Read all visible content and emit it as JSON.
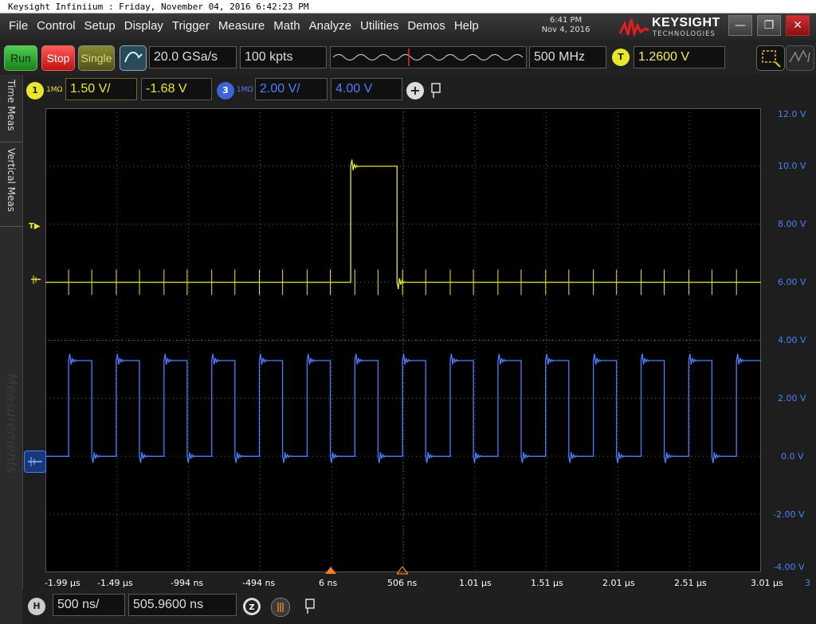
{
  "window": {
    "title": "Keysight Infiniium : Friday, November 04, 2016 6:42:23 PM"
  },
  "menu": [
    "File",
    "Control",
    "Setup",
    "Display",
    "Trigger",
    "Measure",
    "Math",
    "Analyze",
    "Utilities",
    "Demos",
    "Help"
  ],
  "clock": {
    "time": "6:41 PM",
    "date": "Nov 4, 2016"
  },
  "brand": {
    "name": "KEYSIGHT",
    "sub": "TECHNOLOGIES"
  },
  "window_controls": {
    "minimize": "—",
    "restore": "❐",
    "close": "✕"
  },
  "toolbar": {
    "run": "Run",
    "stop": "Stop",
    "single": "Single",
    "sample_rate": "20.0 GSa/s",
    "memory_depth": "100 kpts",
    "bandwidth": "500 MHz",
    "trigger_badge": "T",
    "trigger_level": "1.2600 V"
  },
  "channels": {
    "ch1": {
      "number": "1",
      "impedance": "1MΩ",
      "scale": "1.50 V/",
      "offset": "-1.68 V",
      "color": "#e8e82a"
    },
    "ch3": {
      "number": "3",
      "impedance": "1MΩ",
      "scale": "2.00 V/",
      "offset": "4.00 V",
      "color": "#4a7fff"
    },
    "add_symbol": "+"
  },
  "side_tabs": [
    "Time Meas",
    "Vertical Meas",
    "Measurements"
  ],
  "screen_markers": {
    "trigger": "T"
  },
  "axes": {
    "x_ticks": [
      "-1.99 µs",
      "-1.49 µs",
      "-994 ns",
      "-494 ns",
      "6 ns",
      "506 ns",
      "1.01 µs",
      "1.51 µs",
      "2.01 µs",
      "2.51 µs",
      "3.01 µs"
    ],
    "x_suffix": "3",
    "y_ticks": [
      "12.0 V",
      "10.0 V",
      "8.00 V",
      "6.00 V",
      "4.00 V",
      "2.00 V",
      "0.0 V",
      "-2.00 V",
      "-4.00 V"
    ]
  },
  "horizontal": {
    "badge": "H",
    "scale": "500 ns/",
    "position": "505.9600 ns"
  },
  "chart_data": {
    "type": "line",
    "title": "",
    "xlabel": "",
    "ylabel": "",
    "x_unit": "s",
    "y_unit": "V",
    "xlim": [
      -2.24e-06,
      3.01e-06
    ],
    "ylim": [
      -4.0,
      12.0
    ],
    "grid": true,
    "series": [
      {
        "name": "1",
        "color": "#e8e82a",
        "x": [
          -2.24e-06,
          0.0,
          0.0,
          3.4e-07,
          3.4e-07,
          3.01e-06
        ],
        "y": [
          6.0,
          6.0,
          10.0,
          10.0,
          6.0,
          6.0
        ]
      },
      {
        "name": "3",
        "color": "#4a7fff",
        "x": [
          -2.24e-06,
          -2.07e-06,
          -2.07e-06,
          -1.9e-06,
          -1.9e-06,
          -1.72e-06,
          -1.72e-06,
          -1.55e-06,
          -1.55e-06,
          -1.37e-06,
          -1.37e-06,
          -1.2e-06,
          -1.2e-06,
          -1.02e-06,
          -1.02e-06,
          -8.5e-07,
          -8.5e-07,
          -6.7e-07,
          -6.7e-07,
          -5e-07,
          -5e-07,
          -3.2e-07,
          -3.2e-07,
          -1.5e-07,
          -1.5e-07,
          3e-08,
          3e-08,
          2e-07,
          2e-07,
          3.8e-07,
          3.8e-07,
          5.5e-07,
          5.5e-07,
          7.3e-07,
          7.3e-07,
          9e-07,
          9e-07,
          1.08e-06,
          1.08e-06,
          1.25e-06,
          1.25e-06,
          1.43e-06,
          1.43e-06,
          1.6e-06,
          1.6e-06,
          1.78e-06,
          1.78e-06,
          1.95e-06,
          1.95e-06,
          2.13e-06,
          2.13e-06,
          2.3e-06,
          2.3e-06,
          2.48e-06,
          2.48e-06,
          2.65e-06,
          2.65e-06,
          2.83e-06,
          2.83e-06,
          3.01e-06
        ],
        "y": [
          0.0,
          0.0,
          3.3,
          3.3,
          0.0,
          0.0,
          3.3,
          3.3,
          0.0,
          0.0,
          3.3,
          3.3,
          0.0,
          0.0,
          3.3,
          3.3,
          0.0,
          0.0,
          3.3,
          3.3,
          0.0,
          0.0,
          3.3,
          3.3,
          0.0,
          0.0,
          3.3,
          3.3,
          0.0,
          0.0,
          3.3,
          3.3,
          0.0,
          0.0,
          3.3,
          3.3,
          0.0,
          0.0,
          3.3,
          3.3,
          0.0,
          0.0,
          3.3,
          3.3,
          0.0,
          0.0,
          3.3,
          3.3,
          0.0,
          0.0,
          3.3,
          3.3,
          0.0,
          0.0,
          3.3,
          3.3,
          0.0,
          0.0,
          3.3,
          3.3
        ]
      }
    ]
  }
}
